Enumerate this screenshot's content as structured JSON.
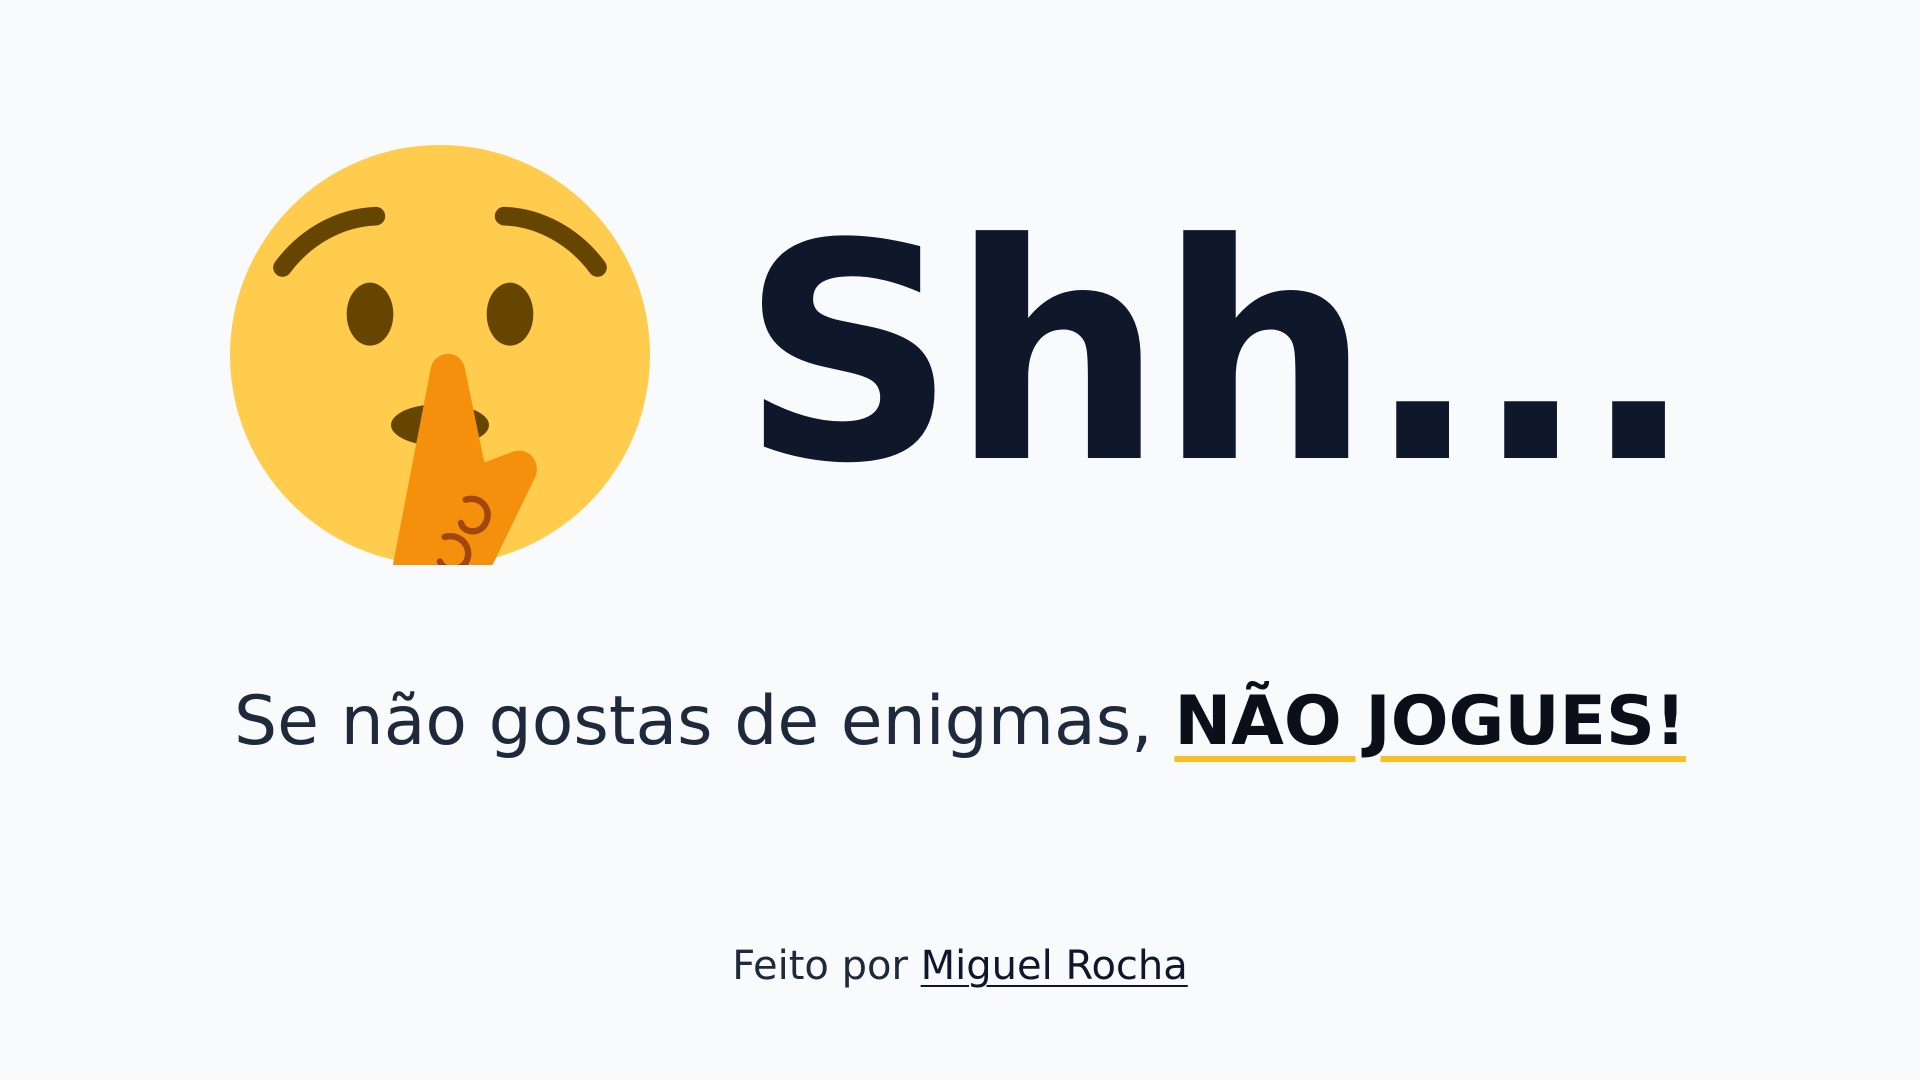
{
  "hero": {
    "emoji_name": "shushing-face-icon",
    "title": "Shh..."
  },
  "subtitle": {
    "text": "Se não gostas de enigmas, ",
    "emphasis": "NÃO JOGUES!"
  },
  "footer": {
    "prefix": "Feito por ",
    "author": "Miguel Rocha"
  },
  "colors": {
    "background": "#f8fafc",
    "text": "#0f172a",
    "accent_underline": "#fbbf24",
    "emoji_face": "#ffcc4d",
    "emoji_hand": "#f4900c",
    "emoji_features": "#664500"
  }
}
